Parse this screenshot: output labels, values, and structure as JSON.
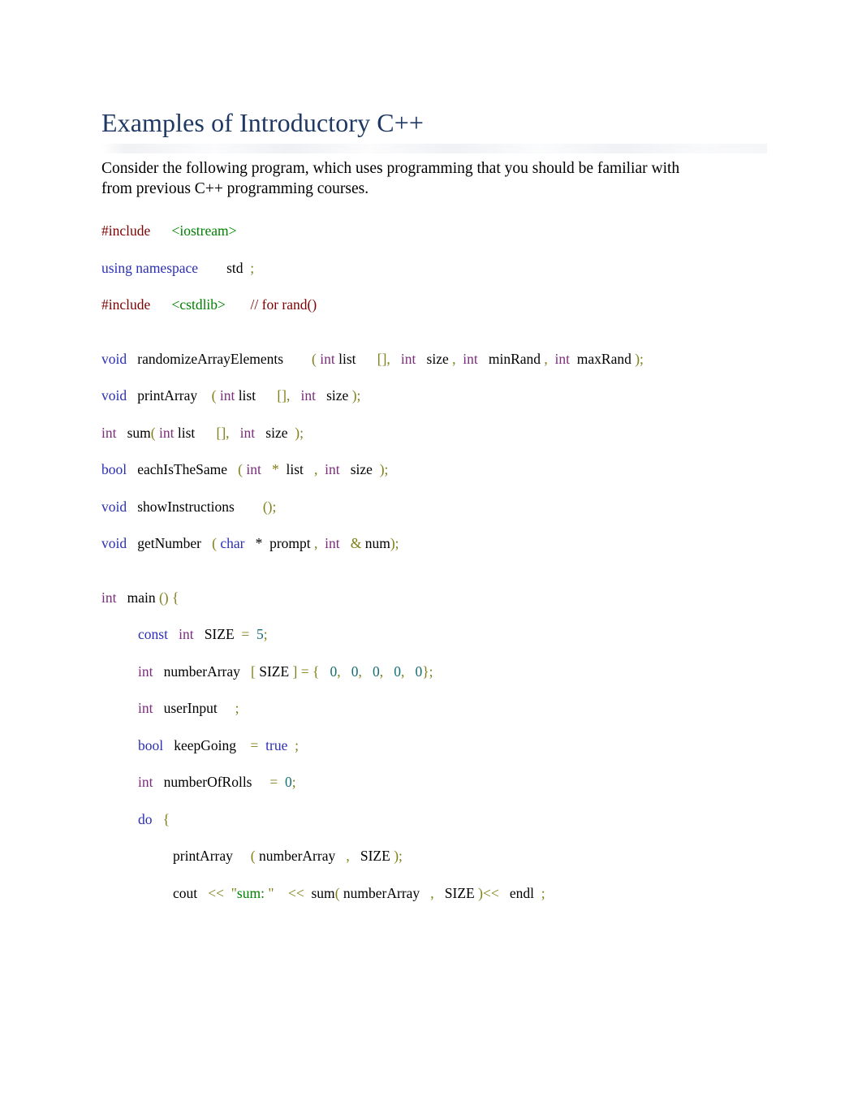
{
  "document": {
    "title": "Examples of Introductory C++",
    "intro_paragraph": "Consider the following program, which uses programming that you should be familiar with from previous C++ programming courses."
  },
  "colors": {
    "title": "#1f3864",
    "keyword": "#2b2fb5",
    "type": "#7b2d7b",
    "preprocessor": "#7f0000",
    "include_header": "#008000",
    "string": "#008000",
    "punctuation": "#7f7f18",
    "number": "#156f73",
    "plain": "#000000",
    "page_background": "#ffffff"
  },
  "code": {
    "lines": [
      {
        "id": "include-iostream",
        "indent": 0,
        "tokens": [
          {
            "t": "#include",
            "c": "pre"
          },
          {
            "t": "      ",
            "c": "plain"
          },
          {
            "t": "<iostream>",
            "c": "inc"
          }
        ]
      },
      {
        "id": "using-namespace-std",
        "indent": 0,
        "tokens": [
          {
            "t": "using namespace",
            "c": "kw"
          },
          {
            "t": "        ",
            "c": "plain"
          },
          {
            "t": "std",
            "c": "plain"
          },
          {
            "t": "  ",
            "c": "plain"
          },
          {
            "t": ";",
            "c": "punct"
          }
        ]
      },
      {
        "id": "include-cstdlib",
        "indent": 0,
        "tokens": [
          {
            "t": "#include",
            "c": "pre"
          },
          {
            "t": "      ",
            "c": "plain"
          },
          {
            "t": "<cstdlib>",
            "c": "inc"
          },
          {
            "t": "       ",
            "c": "plain"
          },
          {
            "t": "// for rand()",
            "c": "pre"
          }
        ]
      },
      {
        "id": "blank-1",
        "indent": 0,
        "blank": true,
        "tokens": []
      },
      {
        "id": "decl-randomizeArrayElements",
        "indent": 0,
        "tokens": [
          {
            "t": "void",
            "c": "kw"
          },
          {
            "t": "   ",
            "c": "plain"
          },
          {
            "t": "randomizeArrayElements",
            "c": "plain"
          },
          {
            "t": "        ",
            "c": "plain"
          },
          {
            "t": "(",
            "c": "punct"
          },
          {
            "t": " ",
            "c": "plain"
          },
          {
            "t": "int",
            "c": "type"
          },
          {
            "t": " ",
            "c": "plain"
          },
          {
            "t": "list",
            "c": "plain"
          },
          {
            "t": "      ",
            "c": "plain"
          },
          {
            "t": "[],",
            "c": "punct"
          },
          {
            "t": "   ",
            "c": "plain"
          },
          {
            "t": "int",
            "c": "type"
          },
          {
            "t": "   ",
            "c": "plain"
          },
          {
            "t": "size",
            "c": "plain"
          },
          {
            "t": " ",
            "c": "plain"
          },
          {
            "t": ",",
            "c": "punct"
          },
          {
            "t": "  ",
            "c": "plain"
          },
          {
            "t": "int",
            "c": "type"
          },
          {
            "t": "   ",
            "c": "plain"
          },
          {
            "t": "minRand",
            "c": "plain"
          },
          {
            "t": " ",
            "c": "plain"
          },
          {
            "t": ",",
            "c": "punct"
          },
          {
            "t": "  ",
            "c": "plain"
          },
          {
            "t": "int",
            "c": "type"
          },
          {
            "t": "  ",
            "c": "plain"
          },
          {
            "t": "maxRand",
            "c": "plain"
          },
          {
            "t": " ",
            "c": "plain"
          },
          {
            "t": ");",
            "c": "punct"
          }
        ]
      },
      {
        "id": "decl-printArray",
        "indent": 0,
        "tokens": [
          {
            "t": "void",
            "c": "kw"
          },
          {
            "t": "   ",
            "c": "plain"
          },
          {
            "t": "printArray",
            "c": "plain"
          },
          {
            "t": "    ",
            "c": "plain"
          },
          {
            "t": "(",
            "c": "punct"
          },
          {
            "t": " ",
            "c": "plain"
          },
          {
            "t": "int",
            "c": "type"
          },
          {
            "t": " ",
            "c": "plain"
          },
          {
            "t": "list",
            "c": "plain"
          },
          {
            "t": "      ",
            "c": "plain"
          },
          {
            "t": "[],",
            "c": "punct"
          },
          {
            "t": "   ",
            "c": "plain"
          },
          {
            "t": "int",
            "c": "type"
          },
          {
            "t": "   ",
            "c": "plain"
          },
          {
            "t": "size",
            "c": "plain"
          },
          {
            "t": " ",
            "c": "plain"
          },
          {
            "t": ");",
            "c": "punct"
          }
        ]
      },
      {
        "id": "decl-sum",
        "indent": 0,
        "tokens": [
          {
            "t": "int",
            "c": "type"
          },
          {
            "t": "   ",
            "c": "plain"
          },
          {
            "t": "sum",
            "c": "plain"
          },
          {
            "t": "(",
            "c": "punct"
          },
          {
            "t": " ",
            "c": "plain"
          },
          {
            "t": "int",
            "c": "type"
          },
          {
            "t": " ",
            "c": "plain"
          },
          {
            "t": "list",
            "c": "plain"
          },
          {
            "t": "      ",
            "c": "plain"
          },
          {
            "t": "[],",
            "c": "punct"
          },
          {
            "t": "   ",
            "c": "plain"
          },
          {
            "t": "int",
            "c": "type"
          },
          {
            "t": "   ",
            "c": "plain"
          },
          {
            "t": "size",
            "c": "plain"
          },
          {
            "t": "  ",
            "c": "plain"
          },
          {
            "t": ");",
            "c": "punct"
          }
        ]
      },
      {
        "id": "decl-eachIsTheSame",
        "indent": 0,
        "tokens": [
          {
            "t": "bool",
            "c": "kw"
          },
          {
            "t": "   ",
            "c": "plain"
          },
          {
            "t": "eachIsTheSame",
            "c": "plain"
          },
          {
            "t": "   ",
            "c": "plain"
          },
          {
            "t": "(",
            "c": "punct"
          },
          {
            "t": " ",
            "c": "plain"
          },
          {
            "t": "int",
            "c": "type"
          },
          {
            "t": "   ",
            "c": "plain"
          },
          {
            "t": "*",
            "c": "punct"
          },
          {
            "t": "  ",
            "c": "plain"
          },
          {
            "t": "list",
            "c": "plain"
          },
          {
            "t": "   ",
            "c": "plain"
          },
          {
            "t": ",",
            "c": "punct"
          },
          {
            "t": "  ",
            "c": "plain"
          },
          {
            "t": "int",
            "c": "type"
          },
          {
            "t": "   ",
            "c": "plain"
          },
          {
            "t": "size",
            "c": "plain"
          },
          {
            "t": "  ",
            "c": "plain"
          },
          {
            "t": ");",
            "c": "punct"
          }
        ]
      },
      {
        "id": "decl-showInstructions",
        "indent": 0,
        "tokens": [
          {
            "t": "void",
            "c": "kw"
          },
          {
            "t": "   ",
            "c": "plain"
          },
          {
            "t": "showInstructions",
            "c": "plain"
          },
          {
            "t": "        ",
            "c": "plain"
          },
          {
            "t": "();",
            "c": "punct"
          }
        ]
      },
      {
        "id": "decl-getNumber",
        "indent": 0,
        "tokens": [
          {
            "t": "void",
            "c": "kw"
          },
          {
            "t": "   ",
            "c": "plain"
          },
          {
            "t": "getNumber",
            "c": "plain"
          },
          {
            "t": "   ",
            "c": "plain"
          },
          {
            "t": "(",
            "c": "punct"
          },
          {
            "t": " ",
            "c": "plain"
          },
          {
            "t": "char",
            "c": "kw"
          },
          {
            "t": "   ",
            "c": "plain"
          },
          {
            "t": "*",
            "c": "plain"
          },
          {
            "t": "  ",
            "c": "plain"
          },
          {
            "t": "prompt",
            "c": "plain"
          },
          {
            "t": " ",
            "c": "plain"
          },
          {
            "t": ",",
            "c": "punct"
          },
          {
            "t": "  ",
            "c": "plain"
          },
          {
            "t": "int",
            "c": "type"
          },
          {
            "t": "   ",
            "c": "plain"
          },
          {
            "t": "&",
            "c": "punct"
          },
          {
            "t": " ",
            "c": "plain"
          },
          {
            "t": "num",
            "c": "plain"
          },
          {
            "t": ");",
            "c": "punct"
          }
        ]
      },
      {
        "id": "blank-2",
        "indent": 0,
        "blank": true,
        "tokens": []
      },
      {
        "id": "main-signature",
        "indent": 0,
        "tokens": [
          {
            "t": "int",
            "c": "type"
          },
          {
            "t": "   ",
            "c": "plain"
          },
          {
            "t": "main",
            "c": "plain"
          },
          {
            "t": " ",
            "c": "plain"
          },
          {
            "t": "()",
            "c": "punct"
          },
          {
            "t": " ",
            "c": "plain"
          },
          {
            "t": "{",
            "c": "punct"
          }
        ]
      },
      {
        "id": "const-size",
        "indent": 1,
        "tokens": [
          {
            "t": "const",
            "c": "kw"
          },
          {
            "t": "   ",
            "c": "plain"
          },
          {
            "t": "int",
            "c": "type"
          },
          {
            "t": "   ",
            "c": "plain"
          },
          {
            "t": "SIZE",
            "c": "plain"
          },
          {
            "t": "  ",
            "c": "plain"
          },
          {
            "t": "=",
            "c": "punct"
          },
          {
            "t": "  ",
            "c": "plain"
          },
          {
            "t": "5",
            "c": "num"
          },
          {
            "t": ";",
            "c": "punct"
          }
        ]
      },
      {
        "id": "numberArray-decl",
        "indent": 1,
        "tokens": [
          {
            "t": "int",
            "c": "type"
          },
          {
            "t": "   ",
            "c": "plain"
          },
          {
            "t": "numberArray",
            "c": "plain"
          },
          {
            "t": "   ",
            "c": "plain"
          },
          {
            "t": "[",
            "c": "punct"
          },
          {
            "t": " ",
            "c": "plain"
          },
          {
            "t": "SIZE",
            "c": "plain"
          },
          {
            "t": " ",
            "c": "plain"
          },
          {
            "t": "] = {",
            "c": "punct"
          },
          {
            "t": "   ",
            "c": "plain"
          },
          {
            "t": "0",
            "c": "num"
          },
          {
            "t": ",",
            "c": "punct"
          },
          {
            "t": "   ",
            "c": "plain"
          },
          {
            "t": "0",
            "c": "num"
          },
          {
            "t": ",",
            "c": "punct"
          },
          {
            "t": "   ",
            "c": "plain"
          },
          {
            "t": "0",
            "c": "num"
          },
          {
            "t": ",",
            "c": "punct"
          },
          {
            "t": "   ",
            "c": "plain"
          },
          {
            "t": "0",
            "c": "num"
          },
          {
            "t": ",",
            "c": "punct"
          },
          {
            "t": "   ",
            "c": "plain"
          },
          {
            "t": "0",
            "c": "num"
          },
          {
            "t": "};",
            "c": "punct"
          }
        ]
      },
      {
        "id": "userInput-decl",
        "indent": 1,
        "tokens": [
          {
            "t": "int",
            "c": "type"
          },
          {
            "t": "   ",
            "c": "plain"
          },
          {
            "t": "userInput",
            "c": "plain"
          },
          {
            "t": "     ",
            "c": "plain"
          },
          {
            "t": ";",
            "c": "punct"
          }
        ]
      },
      {
        "id": "keepGoing-decl",
        "indent": 1,
        "tokens": [
          {
            "t": "bool",
            "c": "kw"
          },
          {
            "t": "   ",
            "c": "plain"
          },
          {
            "t": "keepGoing",
            "c": "plain"
          },
          {
            "t": "    ",
            "c": "plain"
          },
          {
            "t": "=",
            "c": "punct"
          },
          {
            "t": "  ",
            "c": "plain"
          },
          {
            "t": "true",
            "c": "kw"
          },
          {
            "t": "  ",
            "c": "plain"
          },
          {
            "t": ";",
            "c": "punct"
          }
        ]
      },
      {
        "id": "numberOfRolls-decl",
        "indent": 1,
        "tokens": [
          {
            "t": "int",
            "c": "type"
          },
          {
            "t": "   ",
            "c": "plain"
          },
          {
            "t": "numberOfRolls",
            "c": "plain"
          },
          {
            "t": "     ",
            "c": "plain"
          },
          {
            "t": "=",
            "c": "punct"
          },
          {
            "t": "  ",
            "c": "plain"
          },
          {
            "t": "0",
            "c": "num"
          },
          {
            "t": ";",
            "c": "punct"
          }
        ]
      },
      {
        "id": "do-open",
        "indent": 1,
        "tokens": [
          {
            "t": "do",
            "c": "kw"
          },
          {
            "t": "   ",
            "c": "plain"
          },
          {
            "t": "{",
            "c": "punct"
          }
        ]
      },
      {
        "id": "call-printArray",
        "indent": 2,
        "tokens": [
          {
            "t": "printArray",
            "c": "plain"
          },
          {
            "t": "     ",
            "c": "plain"
          },
          {
            "t": "(",
            "c": "punct"
          },
          {
            "t": " ",
            "c": "plain"
          },
          {
            "t": "numberArray",
            "c": "plain"
          },
          {
            "t": "   ",
            "c": "plain"
          },
          {
            "t": ",",
            "c": "punct"
          },
          {
            "t": "   ",
            "c": "plain"
          },
          {
            "t": "SIZE",
            "c": "plain"
          },
          {
            "t": " ",
            "c": "plain"
          },
          {
            "t": ");",
            "c": "punct"
          }
        ]
      },
      {
        "id": "cout-sum",
        "indent": 2,
        "tokens": [
          {
            "t": "cout",
            "c": "plain"
          },
          {
            "t": "   ",
            "c": "plain"
          },
          {
            "t": "<<",
            "c": "punct"
          },
          {
            "t": "  ",
            "c": "plain"
          },
          {
            "t": "\"",
            "c": "punct"
          },
          {
            "t": "sum: ",
            "c": "str"
          },
          {
            "t": "\"",
            "c": "punct"
          },
          {
            "t": "    ",
            "c": "plain"
          },
          {
            "t": "<<",
            "c": "punct"
          },
          {
            "t": "  ",
            "c": "plain"
          },
          {
            "t": "sum",
            "c": "plain"
          },
          {
            "t": "(",
            "c": "punct"
          },
          {
            "t": " ",
            "c": "plain"
          },
          {
            "t": "numberArray",
            "c": "plain"
          },
          {
            "t": "   ",
            "c": "plain"
          },
          {
            "t": ",",
            "c": "punct"
          },
          {
            "t": "   ",
            "c": "plain"
          },
          {
            "t": "SIZE",
            "c": "plain"
          },
          {
            "t": " ",
            "c": "plain"
          },
          {
            "t": ")",
            "c": "punct"
          },
          {
            "t": "<<",
            "c": "punct"
          },
          {
            "t": "   ",
            "c": "plain"
          },
          {
            "t": "endl",
            "c": "plain"
          },
          {
            "t": "  ",
            "c": "plain"
          },
          {
            "t": ";",
            "c": "punct"
          }
        ]
      }
    ]
  }
}
